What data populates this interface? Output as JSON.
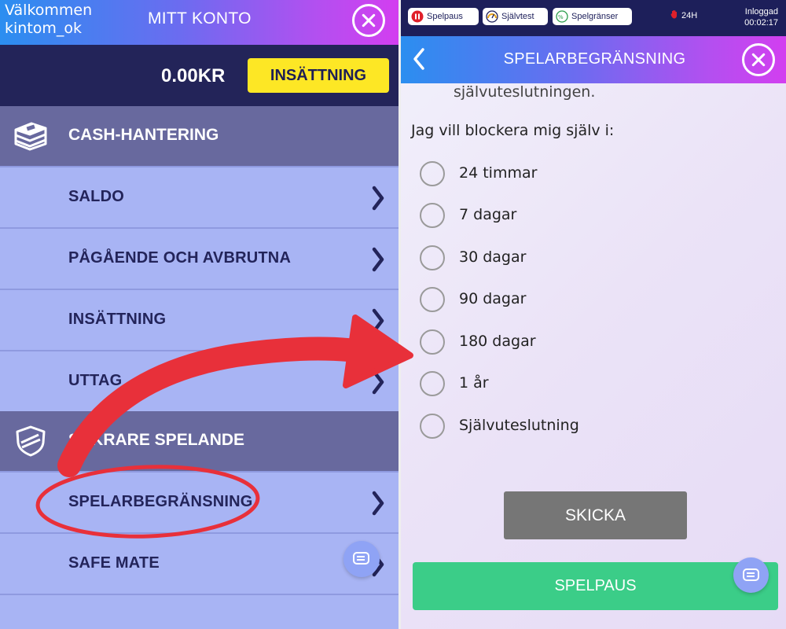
{
  "left_panel": {
    "welcome_line1": "Välkommen",
    "welcome_line2": "kintom_ok",
    "title": "MITT KONTO",
    "balance": "0.00KR",
    "deposit_button": "INSÄTTNING",
    "sections": [
      {
        "title": "CASH-HANTERING",
        "icon": "cash-stack-icon",
        "items": [
          "SALDO",
          "PÅGÅENDE OCH AVBRUTNA",
          "INSÄTTNING",
          "UTTAG"
        ]
      },
      {
        "title": "SÄKRARE SPELANDE",
        "icon": "shield-icon",
        "items": [
          "SPELARBEGRÄNSNING",
          "SAFE MATE"
        ]
      }
    ]
  },
  "right_panel": {
    "status_bar": {
      "pause_pill": "Spelpaus",
      "selftest_pill": "Självtest",
      "limits_pill": "Spelgränser",
      "badge": "24H",
      "login_label": "Inloggad",
      "login_time": "00:02:17"
    },
    "title": "SPELARBEGRÄNSNING",
    "cut_text": "självuteslutningen.",
    "question": "Jag vill blockera mig själv i:",
    "options": [
      "24 timmar",
      "7 dagar",
      "30 dagar",
      "90 dagar",
      "180 dagar",
      "1 år",
      "Självuteslutning"
    ],
    "submit_button": "SKICKA",
    "pause_button": "SPELPAUS"
  },
  "colors": {
    "header_gradient_start": "#2b8ef0",
    "header_gradient_end": "#d33ef0",
    "dark_navy": "#1d1f5a",
    "menu_background": "#a8b4f4",
    "section_background": "#68699e",
    "deposit_yellow": "#fde725",
    "pause_green": "#3bcd88",
    "annotation_red": "#e8303a"
  },
  "icons": [
    "close-icon",
    "chevron-right-icon",
    "chevron-left-icon",
    "chat-icon",
    "pause-icon",
    "gauge-icon",
    "limits-icon",
    "hand-icon"
  ]
}
